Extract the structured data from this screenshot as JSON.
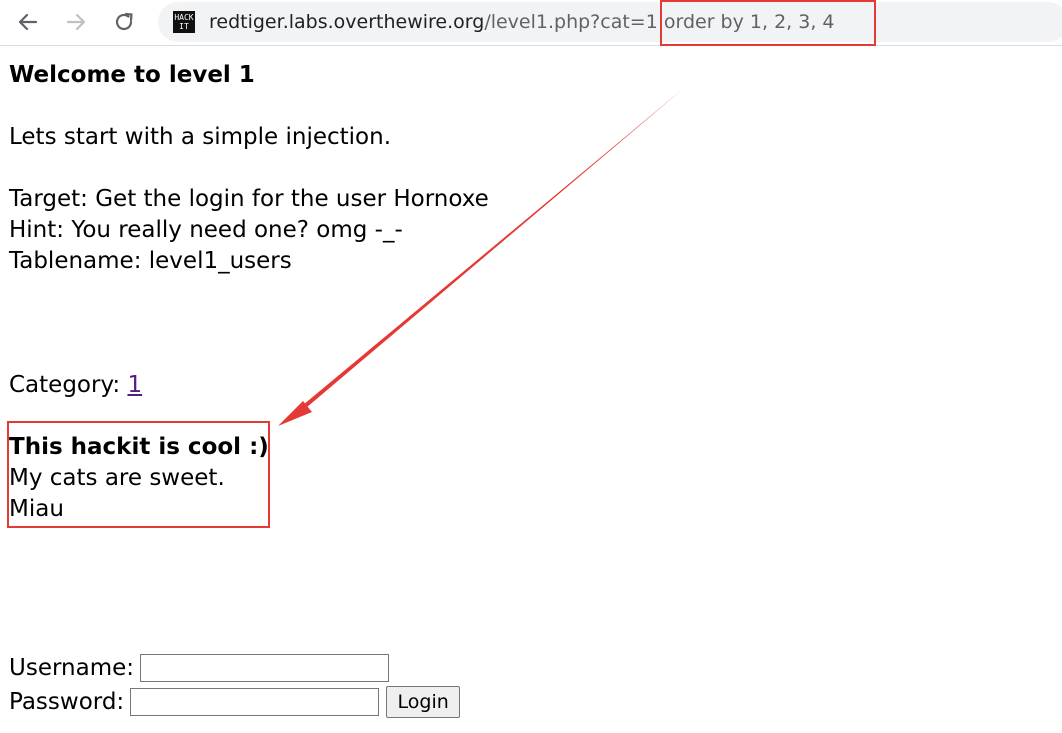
{
  "browser": {
    "url_host": "redtiger.labs.overthewire.org",
    "url_path": "/level1.php?cat=1 order by 1, 2, 3, 4",
    "favicon_text_top": "HACK",
    "favicon_text_bottom": "IT",
    "back_icon": "back-arrow-icon",
    "forward_icon": "forward-arrow-icon",
    "reload_icon": "reload-icon"
  },
  "page": {
    "heading": "Welcome to level 1",
    "intro": "Lets start with a simple injection.",
    "target": "Target: Get the login for the user Hornoxe",
    "hint": "Hint: You really need one? omg -_-",
    "tablename": "Tablename: level1_users",
    "category_label": "Category: ",
    "category_link": "1",
    "result_title": "This hackit is cool :)",
    "result_line1": "My cats are sweet.",
    "result_line2": "Miau"
  },
  "form": {
    "username_label": "Username:",
    "password_label": "Password:",
    "username_value": "",
    "password_value": "",
    "login_button": "Login"
  },
  "annotation": {
    "color": "#e53935"
  }
}
